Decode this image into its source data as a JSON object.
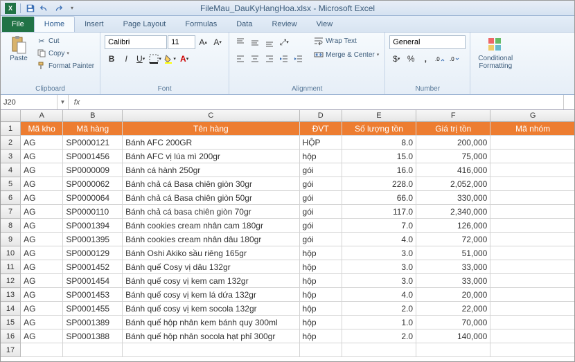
{
  "app": {
    "title": "FileMau_DauKyHangHoa.xlsx  -  Microsoft Excel",
    "name_box": "J20",
    "formula": ""
  },
  "tabs": {
    "file": "File",
    "home": "Home",
    "insert": "Insert",
    "page_layout": "Page Layout",
    "formulas": "Formulas",
    "data": "Data",
    "review": "Review",
    "view": "View"
  },
  "ribbon": {
    "clipboard": {
      "label": "Clipboard",
      "paste": "Paste",
      "cut": "Cut",
      "copy": "Copy",
      "format_painter": "Format Painter"
    },
    "font": {
      "label": "Font",
      "name": "Calibri",
      "size": "11"
    },
    "alignment": {
      "label": "Alignment",
      "wrap": "Wrap Text",
      "merge": "Merge & Center"
    },
    "number": {
      "label": "Number",
      "format": "General"
    },
    "styles": {
      "conditional": "Conditional Formatting"
    }
  },
  "columns": [
    "A",
    "B",
    "C",
    "D",
    "E",
    "F",
    "G"
  ],
  "headers": [
    "Mã kho",
    "Mã hàng",
    "Tên hàng",
    "ĐVT",
    "Số lượng tồn",
    "Giá trị tồn",
    "Mã nhóm"
  ],
  "rows": [
    {
      "n": 2,
      "c": [
        "AG",
        "SP0000121",
        "Bánh AFC 200GR",
        "HỘP",
        "8.0",
        "200,000",
        ""
      ]
    },
    {
      "n": 3,
      "c": [
        "AG",
        "SP0001456",
        "Bánh AFC vị lúa mì 200gr",
        "hộp",
        "15.0",
        "75,000",
        ""
      ]
    },
    {
      "n": 4,
      "c": [
        "AG",
        "SP0000009",
        "Bánh cá hành 250gr",
        "gói",
        "16.0",
        "416,000",
        ""
      ]
    },
    {
      "n": 5,
      "c": [
        "AG",
        "SP0000062",
        "Bánh chả cá Basa chiên giòn 30gr",
        "gói",
        "228.0",
        "2,052,000",
        ""
      ]
    },
    {
      "n": 6,
      "c": [
        "AG",
        "SP0000064",
        "Bánh chả cá Basa chiên giòn 50gr",
        "gói",
        "66.0",
        "330,000",
        ""
      ]
    },
    {
      "n": 7,
      "c": [
        "AG",
        "SP0000110",
        "Bánh chả cá basa chiên giòn 70gr",
        "gói",
        "117.0",
        "2,340,000",
        ""
      ]
    },
    {
      "n": 8,
      "c": [
        "AG",
        "SP0001394",
        "Bánh cookies cream nhân cam 180gr",
        "gói",
        "7.0",
        "126,000",
        ""
      ]
    },
    {
      "n": 9,
      "c": [
        "AG",
        "SP0001395",
        "Bánh cookies cream nhân dâu 180gr",
        "gói",
        "4.0",
        "72,000",
        ""
      ]
    },
    {
      "n": 10,
      "c": [
        "AG",
        "SP0000129",
        "Bánh Oshi Akiko sầu riêng 165gr",
        "hộp",
        "3.0",
        "51,000",
        ""
      ]
    },
    {
      "n": 11,
      "c": [
        "AG",
        "SP0001452",
        "Bánh quế Cosy vị dâu 132gr",
        "hộp",
        "3.0",
        "33,000",
        ""
      ]
    },
    {
      "n": 12,
      "c": [
        "AG",
        "SP0001454",
        "Bánh quế cosy vị kem cam 132gr",
        "hộp",
        "3.0",
        "33,000",
        ""
      ]
    },
    {
      "n": 13,
      "c": [
        "AG",
        "SP0001453",
        "Bánh quế cosy vị kem lá dứa 132gr",
        "hộp",
        "4.0",
        "20,000",
        ""
      ]
    },
    {
      "n": 14,
      "c": [
        "AG",
        "SP0001455",
        "Bánh quế cosy vị kem socola 132gr",
        "hộp",
        "2.0",
        "22,000",
        ""
      ]
    },
    {
      "n": 15,
      "c": [
        "AG",
        "SP0001389",
        "Bánh quế hộp nhân kem bánh quy 300ml",
        "hộp",
        "1.0",
        "70,000",
        ""
      ]
    },
    {
      "n": 16,
      "c": [
        "AG",
        "SP0001388",
        "Bánh quế hộp nhân socola hạt phỉ 300gr",
        "hộp",
        "2.0",
        "140,000",
        ""
      ]
    }
  ],
  "chart_data": {
    "type": "table",
    "title": "FileMau_DauKyHangHoa",
    "columns": [
      "Mã kho",
      "Mã hàng",
      "Tên hàng",
      "ĐVT",
      "Số lượng tồn",
      "Giá trị tồn",
      "Mã nhóm"
    ],
    "data": [
      [
        "AG",
        "SP0000121",
        "Bánh AFC 200GR",
        "HỘP",
        8.0,
        200000,
        null
      ],
      [
        "AG",
        "SP0001456",
        "Bánh AFC vị lúa mì 200gr",
        "hộp",
        15.0,
        75000,
        null
      ],
      [
        "AG",
        "SP0000009",
        "Bánh cá hành 250gr",
        "gói",
        16.0,
        416000,
        null
      ],
      [
        "AG",
        "SP0000062",
        "Bánh chả cá Basa chiên giòn 30gr",
        "gói",
        228.0,
        2052000,
        null
      ],
      [
        "AG",
        "SP0000064",
        "Bánh chả cá Basa chiên giòn 50gr",
        "gói",
        66.0,
        330000,
        null
      ],
      [
        "AG",
        "SP0000110",
        "Bánh chả cá basa chiên giòn 70gr",
        "gói",
        117.0,
        2340000,
        null
      ],
      [
        "AG",
        "SP0001394",
        "Bánh cookies cream nhân cam 180gr",
        "gói",
        7.0,
        126000,
        null
      ],
      [
        "AG",
        "SP0001395",
        "Bánh cookies cream nhân dâu 180gr",
        "gói",
        4.0,
        72000,
        null
      ],
      [
        "AG",
        "SP0000129",
        "Bánh Oshi Akiko sầu riêng 165gr",
        "hộp",
        3.0,
        51000,
        null
      ],
      [
        "AG",
        "SP0001452",
        "Bánh quế Cosy vị dâu 132gr",
        "hộp",
        3.0,
        33000,
        null
      ],
      [
        "AG",
        "SP0001454",
        "Bánh quế cosy vị kem cam 132gr",
        "hộp",
        3.0,
        33000,
        null
      ],
      [
        "AG",
        "SP0001453",
        "Bánh quế cosy vị kem lá dứa 132gr",
        "hộp",
        4.0,
        20000,
        null
      ],
      [
        "AG",
        "SP0001455",
        "Bánh quế cosy vị kem socola 132gr",
        "hộp",
        2.0,
        22000,
        null
      ],
      [
        "AG",
        "SP0001389",
        "Bánh quế hộp nhân kem bánh quy 300ml",
        "hộp",
        1.0,
        70000,
        null
      ],
      [
        "AG",
        "SP0001388",
        "Bánh quế hộp nhân socola hạt phỉ 300gr",
        "hộp",
        2.0,
        140000,
        null
      ]
    ]
  }
}
